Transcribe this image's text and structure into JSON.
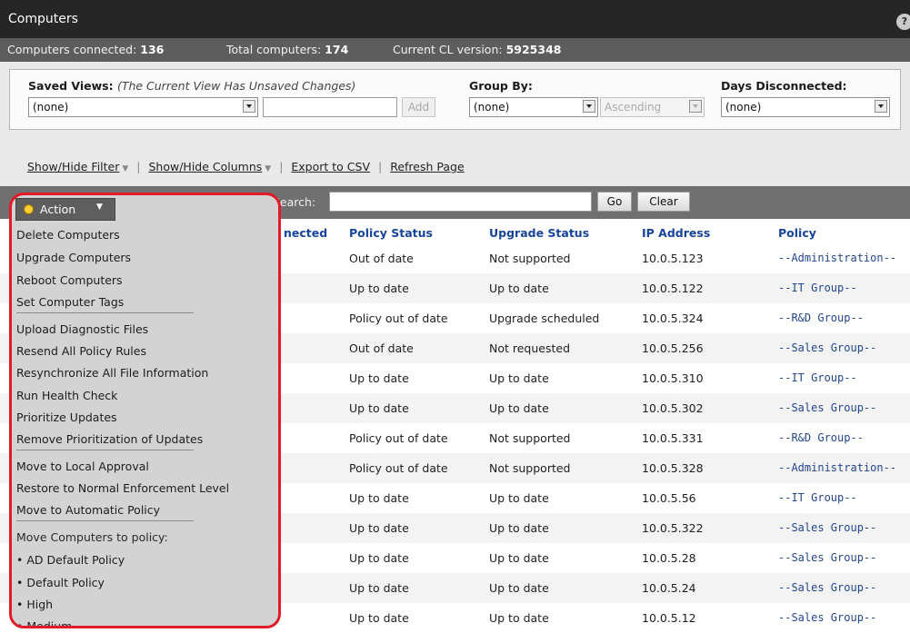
{
  "window": {
    "title": "Computers",
    "help_glyph": "?"
  },
  "stats": {
    "connected_label": "Computers connected:",
    "connected_value": "136",
    "total_label": "Total computers:",
    "total_value": "174",
    "cl_label": "Current CL version:",
    "cl_value": "5925348"
  },
  "filters": {
    "saved_views_label": "Saved Views:",
    "saved_views_note": "(The Current View Has Unsaved Changes)",
    "saved_views_value": "(none)",
    "add_label": "Add",
    "group_by_label": "Group By:",
    "group_by_value": "(none)",
    "order_value": "Ascending",
    "days_label": "Days Disconnected:",
    "days_value": "(none)"
  },
  "links": {
    "show_hide_filter": "Show/Hide Filter",
    "show_hide_columns": "Show/Hide Columns",
    "export_csv": "Export to CSV",
    "refresh": "Refresh Page",
    "separator": "|"
  },
  "toolbar": {
    "action_label": "Action",
    "search_label": "Search:",
    "go_label": "Go",
    "clear_label": "Clear"
  },
  "columns": {
    "connected": "nected",
    "policy_status": "Policy Status",
    "upgrade_status": "Upgrade Status",
    "ip_address": "IP Address",
    "policy": "Policy"
  },
  "rows": [
    {
      "policy_status": "Out of date",
      "upgrade_status": "Not supported",
      "ip": "10.0.5.123",
      "policy": "--Administration--"
    },
    {
      "policy_status": "Up to date",
      "upgrade_status": "Up to date",
      "ip": "10.0.5.122",
      "policy": "--IT Group--"
    },
    {
      "policy_status": "Policy out of date",
      "upgrade_status": "Upgrade scheduled",
      "ip": "10.0.5.324",
      "policy": "--R&D Group--"
    },
    {
      "policy_status": "Out of date",
      "upgrade_status": "Not requested",
      "ip": "10.0.5.256",
      "policy": "--Sales Group--"
    },
    {
      "policy_status": "Up to date",
      "upgrade_status": "Up to date",
      "ip": "10.0.5.310",
      "policy": "--IT Group--"
    },
    {
      "policy_status": "Up to date",
      "upgrade_status": "Up to date",
      "ip": "10.0.5.302",
      "policy": "--Sales Group--"
    },
    {
      "policy_status": "Policy out of date",
      "upgrade_status": "Not supported",
      "ip": "10.0.5.331",
      "policy": "--R&D Group--"
    },
    {
      "policy_status": "Policy out of date",
      "upgrade_status": "Not supported",
      "ip": "10.0.5.328",
      "policy": "--Administration--"
    },
    {
      "policy_status": "Up to date",
      "upgrade_status": "Up to date",
      "ip": "10.0.5.56",
      "policy": "--IT Group--"
    },
    {
      "policy_status": "Up to date",
      "upgrade_status": "Up to date",
      "ip": "10.0.5.322",
      "policy": "--Sales Group--"
    },
    {
      "policy_status": "Up to date",
      "upgrade_status": "Up to date",
      "ip": "10.0.5.28",
      "policy": "--Sales Group--"
    },
    {
      "policy_status": "Up to date",
      "upgrade_status": "Up to date",
      "ip": "10.0.5.24",
      "policy": "--Sales Group--"
    },
    {
      "policy_status": "Up to date",
      "upgrade_status": "Up to date",
      "ip": "10.0.5.12",
      "policy": "--Sales Group--"
    }
  ],
  "action_menu": {
    "items": [
      "Delete Computers",
      "Upgrade Computers",
      "Reboot Computers",
      "Set Computer Tags",
      "Upload Diagnostic Files",
      "Resend All Policy Rules",
      "Resynchronize All File Information",
      "Run Health Check",
      "Prioritize Updates",
      "Remove Prioritization of Updates",
      "Move to Local Approval",
      "Restore to Normal Enforcement Level",
      "Move to Automatic Policy",
      "Move Computers to policy:",
      "• AD Default Policy",
      "• Default Policy",
      "• High",
      "• Medium"
    ]
  },
  "colors": {
    "highlight_border": "#e11b2a",
    "link_blue": "#16449a"
  }
}
